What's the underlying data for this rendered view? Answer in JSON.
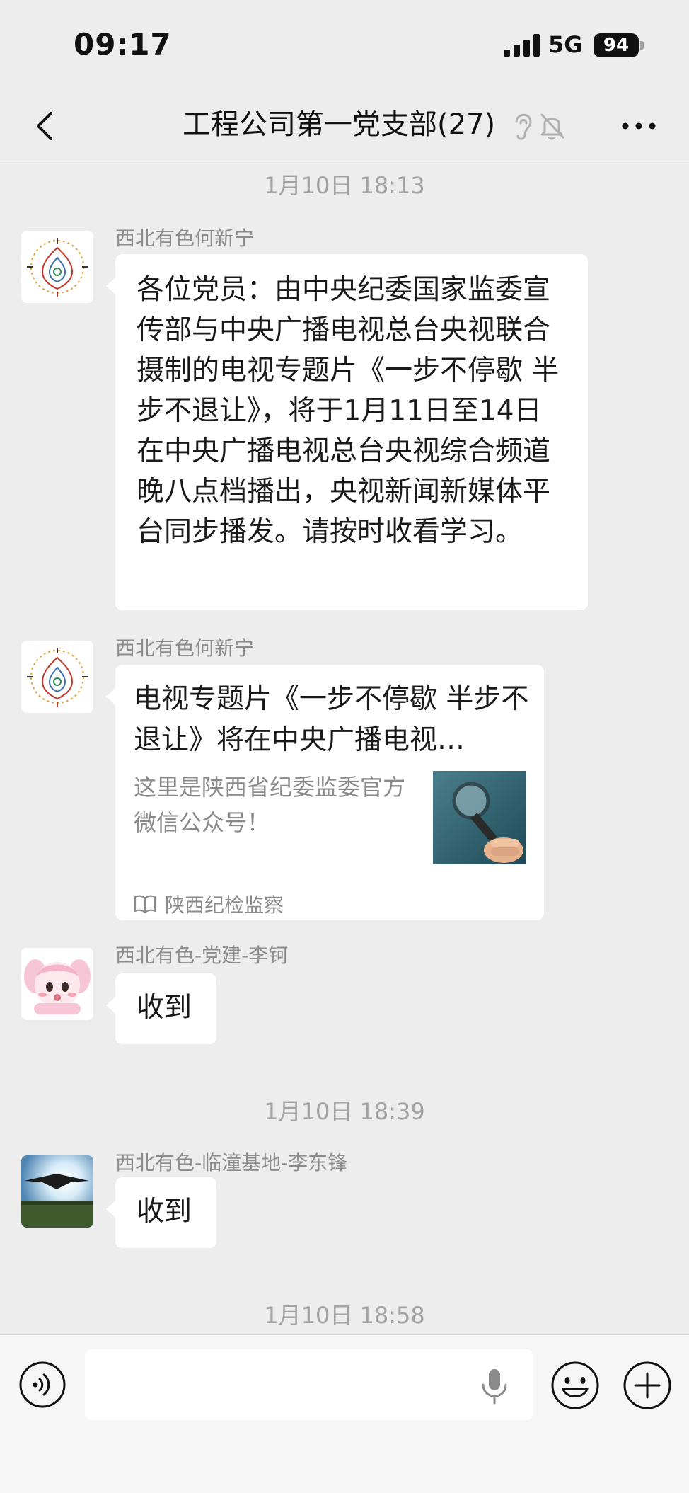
{
  "status_bar": {
    "time": "09:17",
    "network": "5G",
    "battery": "94"
  },
  "nav": {
    "title": "工程公司第一党支部(27)",
    "icons": [
      "back-icon",
      "ear-icon",
      "bell-muted-icon",
      "more-icon"
    ]
  },
  "chat": {
    "timestamps": [
      "1月10日 18:13",
      "1月10日 18:39",
      "1月10日 18:58"
    ],
    "messages": [
      {
        "sender": "西北有色何新宁",
        "text": "各位党员：由中央纪委国家监委宣传部与中央广播电视总台央视联合摄制的电视专题片《一步不停歇 半步不退让》，将于1月11日至14日在中央广播电视总台央视综合频道晚八点档播出，央视新闻新媒体平台同步播发。请按时收看学习。"
      },
      {
        "sender": "西北有色何新宁",
        "card": {
          "title": "电视专题片《一步不停歇 半步不退让》将在中央广播电视…",
          "description": "这里是陕西省纪委监委官方微信公众号！",
          "source": "陕西纪检监察"
        }
      },
      {
        "sender": "西北有色-党建-李钶",
        "text": "收到"
      },
      {
        "sender": "西北有色-临潼基地-李东锋",
        "text": "收到"
      }
    ]
  },
  "input_bar": {
    "placeholder": "",
    "icons": [
      "voice-icon",
      "mic-icon",
      "emoji-icon",
      "plus-icon"
    ]
  },
  "colors": {
    "background": "#ededed",
    "bubble": "#ffffff",
    "timestamp": "#a2a2a2",
    "sender": "#8c8c8c"
  }
}
